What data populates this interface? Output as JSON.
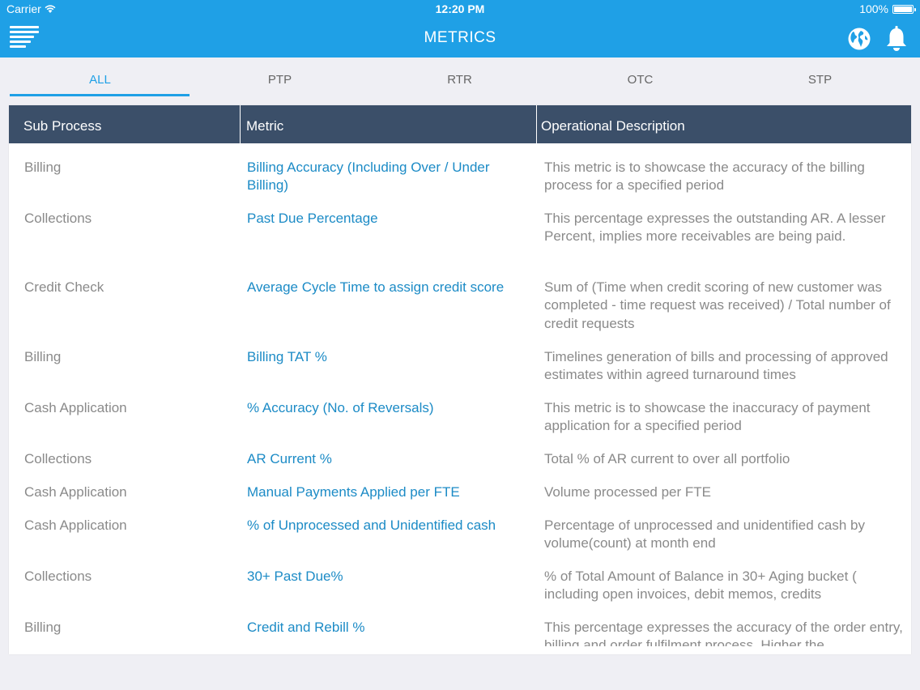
{
  "status_bar": {
    "carrier": "Carrier",
    "time": "12:20 PM",
    "battery": "100%"
  },
  "nav": {
    "title": "METRICS",
    "menu_icon": "menu-icon",
    "globe_icon": "globe-icon",
    "bell_icon": "bell-icon"
  },
  "tabs": [
    {
      "label": "ALL",
      "active": true
    },
    {
      "label": "PTP",
      "active": false
    },
    {
      "label": "RTR",
      "active": false
    },
    {
      "label": "OTC",
      "active": false
    },
    {
      "label": "STP",
      "active": false
    }
  ],
  "table": {
    "headers": [
      "Sub Process",
      "Metric",
      "Operational Description"
    ],
    "rows": [
      {
        "sub": "Billing",
        "metric": "Billing Accuracy (Including Over / Under Billing)",
        "desc": "This metric is to showcase the accuracy of the billing process for a specified period"
      },
      {
        "sub": "Collections",
        "metric": "Past Due Percentage",
        "desc": "This percentage expresses the outstanding AR.  A lesser Percent, implies more receivables are being paid."
      },
      {
        "sub": "Credit Check",
        "metric": "Average Cycle Time to assign credit score",
        "desc": "Sum of (Time when credit scoring of new customer was completed - time request was received) / Total number of credit requests"
      },
      {
        "sub": "Billing",
        "metric": "Billing TAT %",
        "desc": "Timelines generation of bills and processing of approved estimates within agreed turnaround times"
      },
      {
        "sub": "Cash Application",
        "metric": "% Accuracy (No. of Reversals)",
        "desc": "This metric is to showcase the inaccuracy of payment application for a specified period"
      },
      {
        "sub": "Collections",
        "metric": "AR Current %",
        "desc": "Total % of AR current to over all portfolio"
      },
      {
        "sub": "Cash Application",
        "metric": "Manual Payments Applied per FTE",
        "desc": "Volume processed per FTE"
      },
      {
        "sub": "Cash Application",
        "metric": "% of Unprocessed and Unidentified cash",
        "desc": "Percentage of unprocessed and unidentified cash by volume(count) at month end"
      },
      {
        "sub": "Collections",
        "metric": "30+ Past Due%",
        "desc": "% of Total Amount of Balance in 30+ Aging bucket ( including open invoices, debit memos, credits"
      },
      {
        "sub": "Billing",
        "metric": "Credit and Rebill %",
        "desc": "This percentage expresses the accuracy of the order entry, billing and order fulfilment process. Higher the"
      }
    ]
  },
  "colors": {
    "accent": "#1fa0e6",
    "header_bg": "#3b4f69",
    "metric_text": "#1c8bc6",
    "muted_text": "#8a8a8a"
  }
}
